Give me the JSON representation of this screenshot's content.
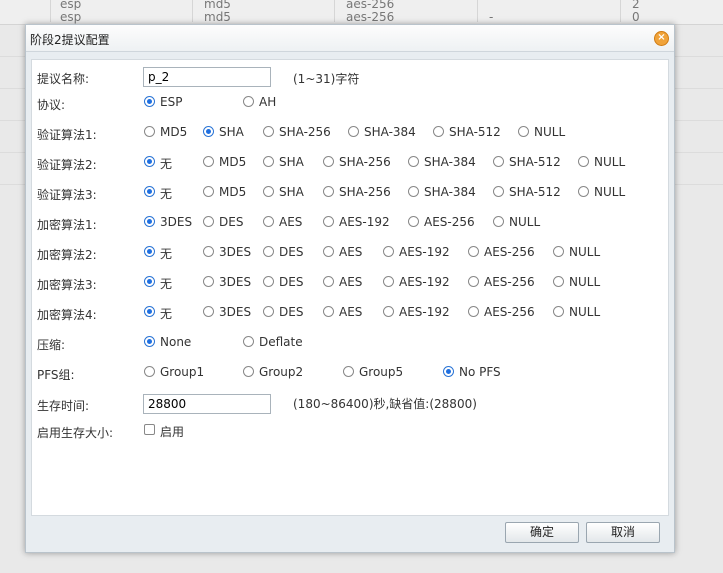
{
  "background": {
    "rows": [
      {
        "c1": "esp",
        "c2": "md5",
        "c3": "aes-256",
        "c4": "",
        "c5": "2"
      },
      {
        "c1": "esp",
        "c2": "md5",
        "c3": "aes-256",
        "c4": "-",
        "c5": "0"
      }
    ]
  },
  "dialog": {
    "title": "阶段2提议配置",
    "close_symbol": "×",
    "name": {
      "label": "提议名称:",
      "value": "p_2",
      "hint": "(1~31)字符"
    },
    "protocol": {
      "label": "协议:",
      "options": [
        "ESP",
        "AH"
      ],
      "selected": "ESP"
    },
    "auth1": {
      "label": "验证算法1:",
      "options": [
        "MD5",
        "SHA",
        "SHA-256",
        "SHA-384",
        "SHA-512",
        "NULL"
      ],
      "selected": "SHA"
    },
    "auth2": {
      "label": "验证算法2:",
      "options": [
        "无",
        "MD5",
        "SHA",
        "SHA-256",
        "SHA-384",
        "SHA-512",
        "NULL"
      ],
      "selected": "无"
    },
    "auth3": {
      "label": "验证算法3:",
      "options": [
        "无",
        "MD5",
        "SHA",
        "SHA-256",
        "SHA-384",
        "SHA-512",
        "NULL"
      ],
      "selected": "无"
    },
    "enc1": {
      "label": "加密算法1:",
      "options": [
        "3DES",
        "DES",
        "AES",
        "AES-192",
        "AES-256",
        "NULL"
      ],
      "selected": "3DES"
    },
    "enc2": {
      "label": "加密算法2:",
      "options": [
        "无",
        "3DES",
        "DES",
        "AES",
        "AES-192",
        "AES-256",
        "NULL"
      ],
      "selected": "无"
    },
    "enc3": {
      "label": "加密算法3:",
      "options": [
        "无",
        "3DES",
        "DES",
        "AES",
        "AES-192",
        "AES-256",
        "NULL"
      ],
      "selected": "无"
    },
    "enc4": {
      "label": "加密算法4:",
      "options": [
        "无",
        "3DES",
        "DES",
        "AES",
        "AES-192",
        "AES-256",
        "NULL"
      ],
      "selected": "无"
    },
    "compress": {
      "label": "压缩:",
      "options": [
        "None",
        "Deflate"
      ],
      "selected": "None"
    },
    "pfs": {
      "label": "PFS组:",
      "options": [
        "Group1",
        "Group2",
        "Group5",
        "No PFS"
      ],
      "selected": "No PFS"
    },
    "lifetime": {
      "label": "生存时间:",
      "value": "28800",
      "hint": "(180~86400)秒,缺省值:(28800)"
    },
    "lifesize": {
      "label": "启用生存大小:",
      "checkbox_label": "启用",
      "checked": false
    },
    "ok_label": "确定",
    "cancel_label": "取消"
  }
}
